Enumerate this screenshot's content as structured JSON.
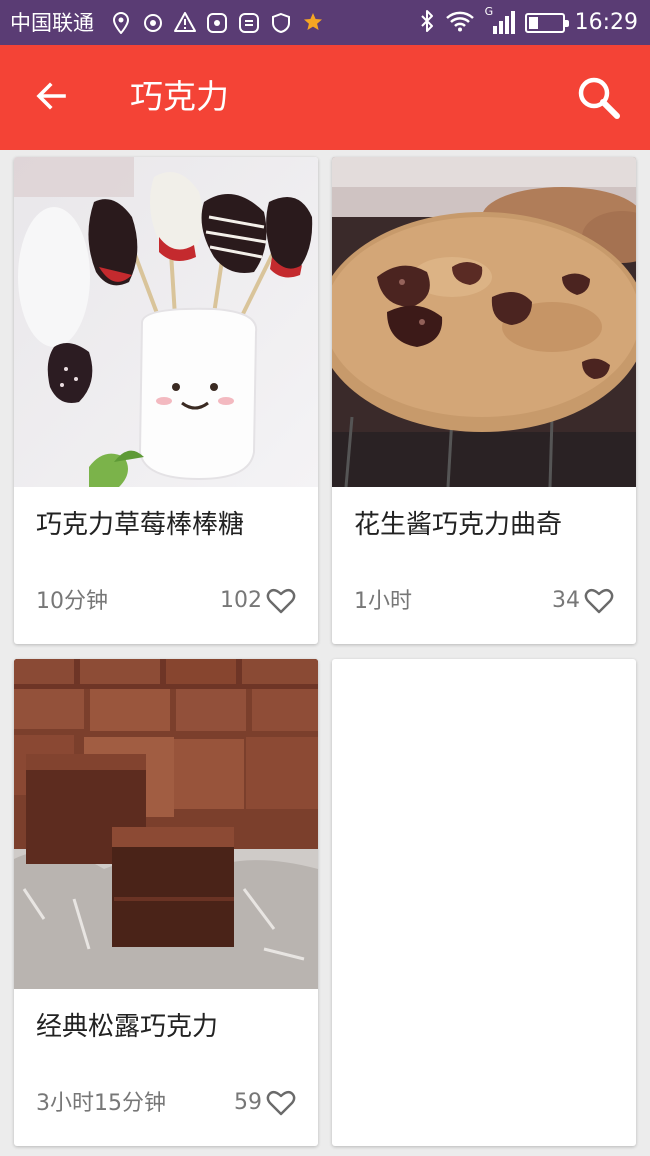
{
  "status_bar": {
    "carrier": "中国联通",
    "time": "16:29",
    "network_label": "G",
    "colors": {
      "background": "#5a3c74"
    }
  },
  "toolbar": {
    "title": "巧克力",
    "back_icon": "arrow-left-icon",
    "search_icon": "search-icon",
    "colors": {
      "background": "#f44336",
      "text": "#ffffff"
    }
  },
  "recipes": [
    {
      "name": "巧克力草莓棒棒糖",
      "duration": "10分钟",
      "likes": "102"
    },
    {
      "name": "花生酱巧克力曲奇",
      "duration": "1小时",
      "likes": "34"
    },
    {
      "name": "经典松露巧克力",
      "duration": "3小时15分钟",
      "likes": "59"
    }
  ]
}
